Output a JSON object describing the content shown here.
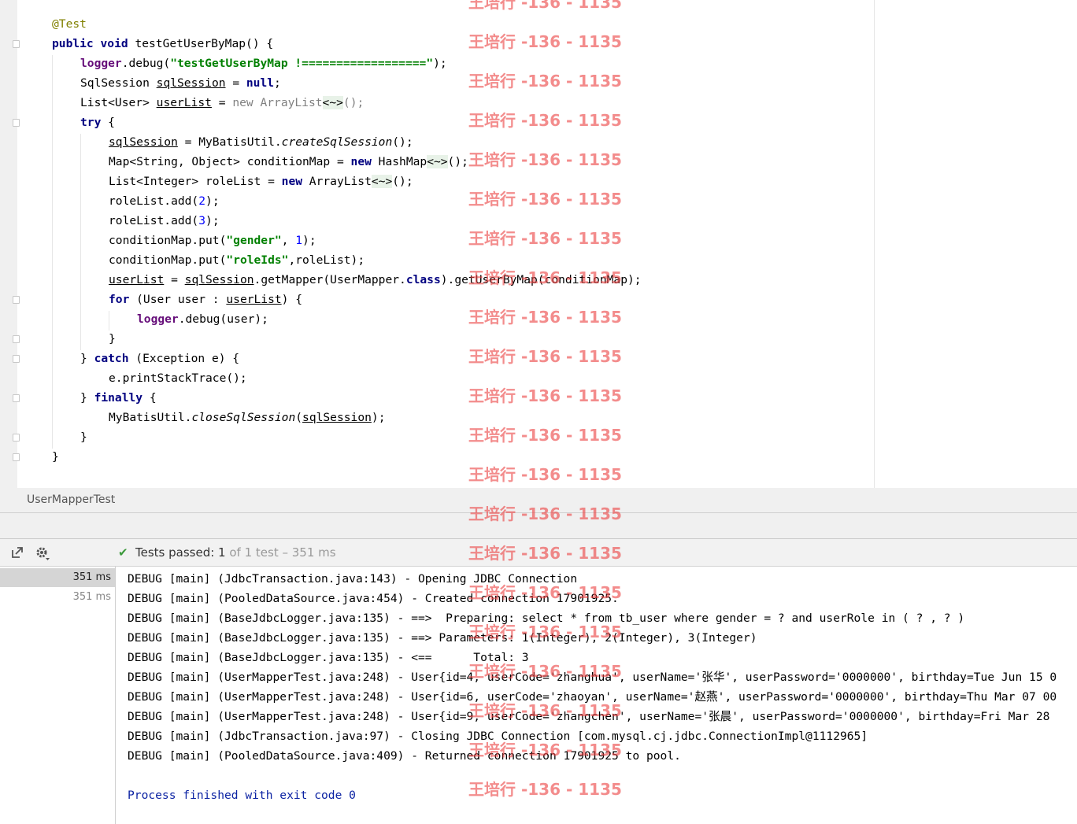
{
  "editor": {
    "lines": [
      [
        {
          "t": "@Test",
          "c": "ann"
        }
      ],
      [
        {
          "t": "public",
          "c": "kw"
        },
        {
          "t": " "
        },
        {
          "t": "void",
          "c": "kw"
        },
        {
          "t": " testGetUserByMap() {"
        }
      ],
      [
        {
          "t": "logger",
          "c": "fld"
        },
        {
          "t": ".debug("
        },
        {
          "t": "\"testGetUserByMap !==================\"",
          "c": "str"
        },
        {
          "t": ");"
        }
      ],
      [
        {
          "t": "SqlSession "
        },
        {
          "t": "sqlSession",
          "c": "ul"
        },
        {
          "t": " = "
        },
        {
          "t": "null",
          "c": "kw"
        },
        {
          "t": ";"
        }
      ],
      [
        {
          "t": "List<User> "
        },
        {
          "t": "userList",
          "c": "ul"
        },
        {
          "t": " = "
        },
        {
          "t": "new ArrayList",
          "c": "grey"
        },
        {
          "t": "<~>",
          "c": "diam"
        },
        {
          "t": "();",
          "c": "grey"
        }
      ],
      [
        {
          "t": "try",
          "c": "kw"
        },
        {
          "t": " {"
        }
      ],
      [
        {
          "t": "sqlSession",
          "c": "ul"
        },
        {
          "t": " = MyBatisUtil."
        },
        {
          "t": "createSqlSession",
          "c": "ital"
        },
        {
          "t": "();"
        }
      ],
      [
        {
          "t": "Map<String, Object> conditionMap = "
        },
        {
          "t": "new",
          "c": "kw"
        },
        {
          "t": " HashMap"
        },
        {
          "t": "<~>",
          "c": "diam"
        },
        {
          "t": "();"
        }
      ],
      [
        {
          "t": "List<Integer> roleList = "
        },
        {
          "t": "new",
          "c": "kw"
        },
        {
          "t": " ArrayList"
        },
        {
          "t": "<~>",
          "c": "diam"
        },
        {
          "t": "();"
        }
      ],
      [
        {
          "t": "roleList.add("
        },
        {
          "t": "2",
          "c": "num"
        },
        {
          "t": ");"
        }
      ],
      [
        {
          "t": "roleList.add("
        },
        {
          "t": "3",
          "c": "num"
        },
        {
          "t": ");"
        }
      ],
      [
        {
          "t": "conditionMap.put("
        },
        {
          "t": "\"gender\"",
          "c": "str"
        },
        {
          "t": ", "
        },
        {
          "t": "1",
          "c": "num"
        },
        {
          "t": ");"
        }
      ],
      [
        {
          "t": "conditionMap.put("
        },
        {
          "t": "\"roleIds\"",
          "c": "str"
        },
        {
          "t": ",roleList);"
        }
      ],
      [
        {
          "t": "userList",
          "c": "ul"
        },
        {
          "t": " = "
        },
        {
          "t": "sqlSession",
          "c": "ul"
        },
        {
          "t": ".getMapper(UserMapper."
        },
        {
          "t": "class",
          "c": "kw"
        },
        {
          "t": ").getUserByMap(conditionMap);"
        }
      ],
      [
        {
          "t": "for",
          "c": "kw"
        },
        {
          "t": " (User user : "
        },
        {
          "t": "userList",
          "c": "ul"
        },
        {
          "t": ") {"
        }
      ],
      [
        {
          "t": "logger",
          "c": "fld"
        },
        {
          "t": ".debug(user);"
        }
      ],
      [
        {
          "t": "}"
        }
      ],
      [
        {
          "t": "} "
        },
        {
          "t": "catch",
          "c": "kw"
        },
        {
          "t": " (Exception e) {"
        }
      ],
      [
        {
          "t": "e.printStackTrace();"
        }
      ],
      [
        {
          "t": "} "
        },
        {
          "t": "finally",
          "c": "kw"
        },
        {
          "t": " {"
        }
      ],
      [
        {
          "t": "MyBatisUtil."
        },
        {
          "t": "closeSqlSession",
          "c": "ital"
        },
        {
          "t": "("
        },
        {
          "t": "sqlSession",
          "c": "ul"
        },
        {
          "t": ");"
        }
      ],
      [
        {
          "t": "}"
        }
      ],
      [
        {
          "t": "}"
        }
      ]
    ]
  },
  "tab": {
    "label": "UserMapperTest"
  },
  "run_toolbar": {
    "icons": [
      "export-icon",
      "gear-icon"
    ],
    "status_prefix": "Tests passed: ",
    "passed_count": "1",
    "status_suffix": " of 1 test – 351 ms"
  },
  "results_tree": {
    "rows": [
      {
        "label": "351 ms",
        "selected": true
      },
      {
        "label": "351 ms",
        "selected": false
      }
    ]
  },
  "console": {
    "lines": [
      "DEBUG [main] (JdbcTransaction.java:143) - Opening JDBC Connection",
      "DEBUG [main] (PooledDataSource.java:454) - Created connection 17901925.",
      "DEBUG [main] (BaseJdbcLogger.java:135) - ==>  Preparing: select * from tb_user where gender = ? and userRole in ( ? , ? )",
      "DEBUG [main] (BaseJdbcLogger.java:135) - ==> Parameters: 1(Integer), 2(Integer), 3(Integer)",
      "DEBUG [main] (BaseJdbcLogger.java:135) - <==      Total: 3",
      "DEBUG [main] (UserMapperTest.java:248) - User{id=4, userCode='zhanghua', userName='张华', userPassword='0000000', birthday=Tue Jun 15 0",
      "DEBUG [main] (UserMapperTest.java:248) - User{id=6, userCode='zhaoyan', userName='赵燕', userPassword='0000000', birthday=Thu Mar 07 00",
      "DEBUG [main] (UserMapperTest.java:248) - User{id=9, userCode='zhangchen', userName='张晨', userPassword='0000000', birthday=Fri Mar 28",
      "DEBUG [main] (JdbcTransaction.java:97) - Closing JDBC Connection [com.mysql.cj.jdbc.ConnectionImpl@1112965]",
      "DEBUG [main] (PooledDataSource.java:409) - Returned connection 17901925 to pool.",
      "",
      "Process finished with exit code 0"
    ]
  },
  "watermark": {
    "text": "王培行 -136 - 1135"
  }
}
